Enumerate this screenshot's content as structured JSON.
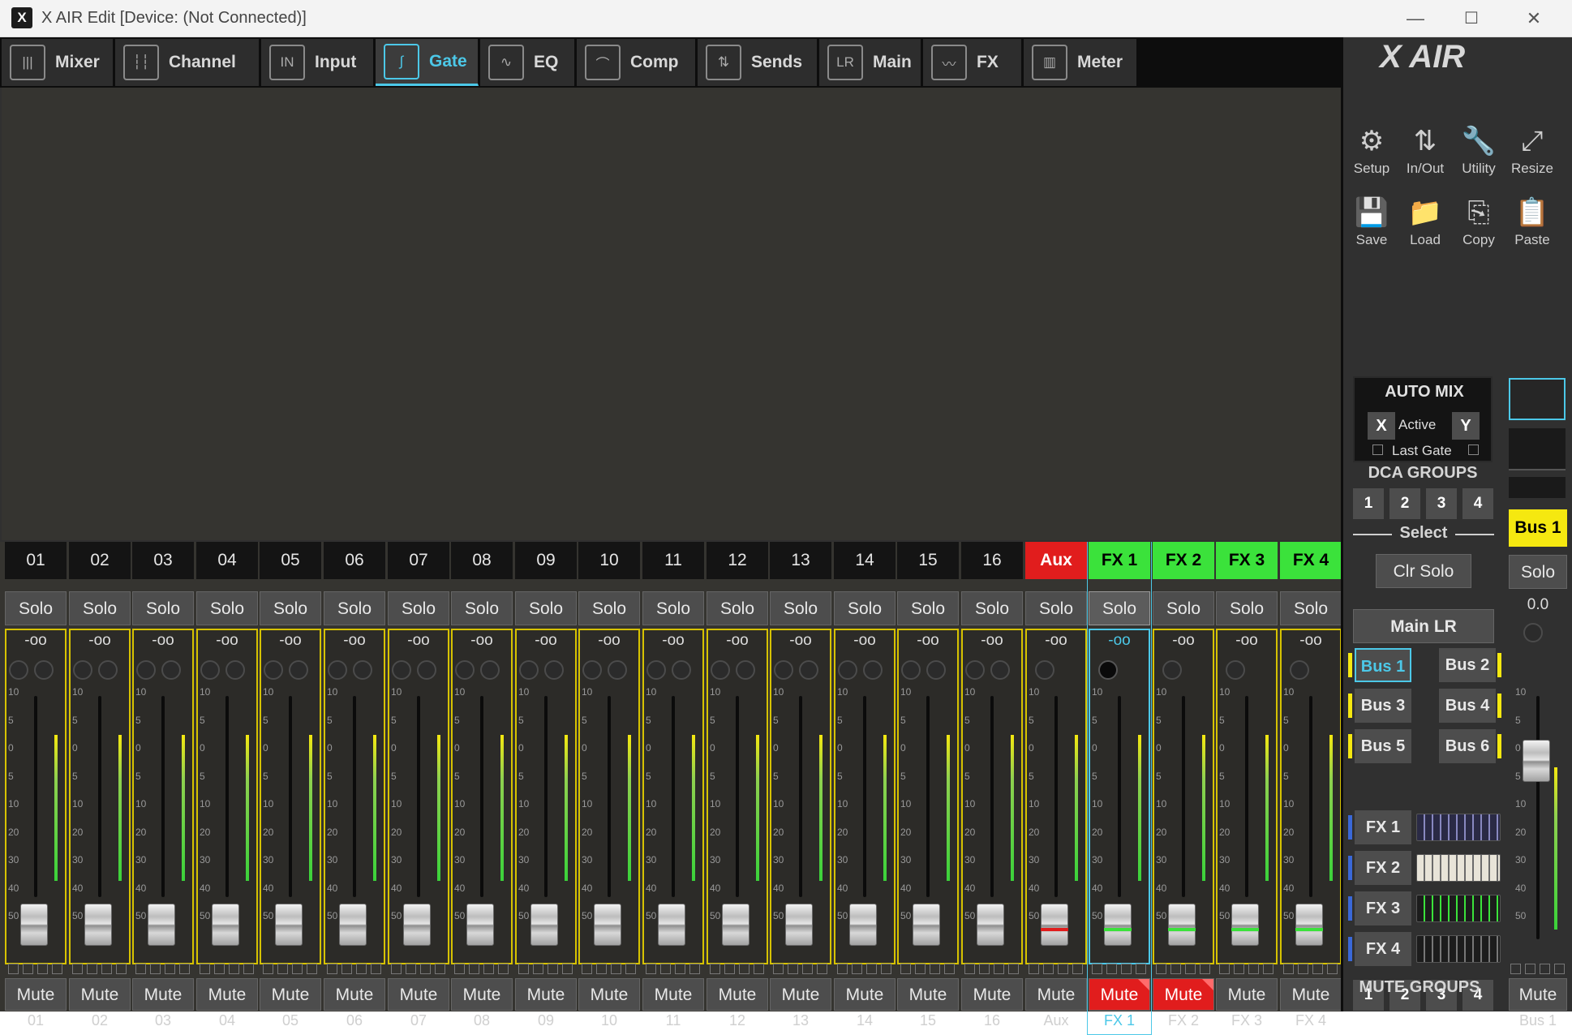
{
  "window": {
    "title": "X AIR Edit [Device: (Not Connected)]",
    "app_icon": "X",
    "minimize": "—",
    "maximize": "☐",
    "close": "✕"
  },
  "tabs": [
    {
      "label": "Mixer",
      "icon": "mixer-icon",
      "glyph": "|||"
    },
    {
      "label": "Channel",
      "icon": "channel-icon",
      "glyph": "┆┆"
    },
    {
      "label": "Input",
      "icon": "input-icon",
      "glyph": "IN"
    },
    {
      "label": "Gate",
      "icon": "gate-icon",
      "glyph": "∫"
    },
    {
      "label": "EQ",
      "icon": "eq-icon",
      "glyph": "∿"
    },
    {
      "label": "Comp",
      "icon": "comp-icon",
      "glyph": "⌒"
    },
    {
      "label": "Sends",
      "icon": "sends-icon",
      "glyph": "⇅"
    },
    {
      "label": "Main",
      "icon": "main-icon",
      "glyph": "LR"
    },
    {
      "label": "FX",
      "icon": "fx-icon",
      "glyph": "〰"
    },
    {
      "label": "Meter",
      "icon": "meter-icon",
      "glyph": "▥"
    }
  ],
  "active_tab": "Gate",
  "channels": [
    {
      "num": "01",
      "name": "01",
      "gain": "-oo",
      "solo": "Solo",
      "mute": "Mute"
    },
    {
      "num": "02",
      "name": "02",
      "gain": "-oo",
      "solo": "Solo",
      "mute": "Mute"
    },
    {
      "num": "03",
      "name": "03",
      "gain": "-oo",
      "solo": "Solo",
      "mute": "Mute"
    },
    {
      "num": "04",
      "name": "04",
      "gain": "-oo",
      "solo": "Solo",
      "mute": "Mute"
    },
    {
      "num": "05",
      "name": "05",
      "gain": "-oo",
      "solo": "Solo",
      "mute": "Mute"
    },
    {
      "num": "06",
      "name": "06",
      "gain": "-oo",
      "solo": "Solo",
      "mute": "Mute"
    },
    {
      "num": "07",
      "name": "07",
      "gain": "-oo",
      "solo": "Solo",
      "mute": "Mute"
    },
    {
      "num": "08",
      "name": "08",
      "gain": "-oo",
      "solo": "Solo",
      "mute": "Mute"
    },
    {
      "num": "09",
      "name": "09",
      "gain": "-oo",
      "solo": "Solo",
      "mute": "Mute"
    },
    {
      "num": "10",
      "name": "10",
      "gain": "-oo",
      "solo": "Solo",
      "mute": "Mute"
    },
    {
      "num": "11",
      "name": "11",
      "gain": "-oo",
      "solo": "Solo",
      "mute": "Mute"
    },
    {
      "num": "12",
      "name": "12",
      "gain": "-oo",
      "solo": "Solo",
      "mute": "Mute"
    },
    {
      "num": "13",
      "name": "13",
      "gain": "-oo",
      "solo": "Solo",
      "mute": "Mute"
    },
    {
      "num": "14",
      "name": "14",
      "gain": "-oo",
      "solo": "Solo",
      "mute": "Mute"
    },
    {
      "num": "15",
      "name": "15",
      "gain": "-oo",
      "solo": "Solo",
      "mute": "Mute"
    },
    {
      "num": "16",
      "name": "16",
      "gain": "-oo",
      "solo": "Solo",
      "mute": "Mute"
    },
    {
      "num": "Aux",
      "name": "Aux",
      "gain": "-oo",
      "solo": "Solo",
      "mute": "Mute"
    },
    {
      "num": "FX 1",
      "name": "FX 1",
      "gain": "-oo",
      "solo": "Solo",
      "mute": "Mute"
    },
    {
      "num": "FX 2",
      "name": "FX 2",
      "gain": "-oo",
      "solo": "Solo",
      "mute": "Mute"
    },
    {
      "num": "FX 3",
      "name": "FX 3",
      "gain": "-oo",
      "solo": "Solo",
      "mute": "Mute"
    },
    {
      "num": "FX 4",
      "name": "FX 4",
      "gain": "-oo",
      "solo": "Solo",
      "mute": "Mute"
    }
  ],
  "fader_scale": [
    "10",
    "5",
    "0",
    "5",
    "10",
    "20",
    "30",
    "40",
    "50"
  ],
  "colors": {
    "aux": "#e11d1d",
    "fx": "#3be23b",
    "bus": "#f5e810",
    "accent": "#4cc8e8",
    "frame": "#d6c200",
    "mute_on": "#e11d1d"
  },
  "right_panel": {
    "logo": "X AIR",
    "tools": [
      {
        "label": "Setup",
        "icon": "gear-icon",
        "glyph": "⚙"
      },
      {
        "label": "In/Out",
        "icon": "in-out-icon",
        "glyph": "⇅"
      },
      {
        "label": "Utility",
        "icon": "wrench-icon",
        "glyph": "🔧"
      },
      {
        "label": "Resize",
        "icon": "resize-icon",
        "glyph": "⤢"
      },
      {
        "label": "Save",
        "icon": "save-icon",
        "glyph": "💾"
      },
      {
        "label": "Load",
        "icon": "folder-icon",
        "glyph": "📁"
      },
      {
        "label": "Copy",
        "icon": "copy-icon",
        "glyph": "⎘"
      },
      {
        "label": "Paste",
        "icon": "paste-icon",
        "glyph": "📋"
      }
    ],
    "automix": {
      "title": "AUTO MIX",
      "x": "X",
      "y": "Y",
      "active": "Active",
      "last_gate": "Last Gate"
    },
    "dca": {
      "title": "DCA GROUPS",
      "buttons": [
        "1",
        "2",
        "3",
        "4"
      ]
    },
    "select_label": "Select",
    "clr_solo": "Clr Solo",
    "main_lr": "Main LR",
    "buses": [
      "Bus 1",
      "Bus 2",
      "Bus 3",
      "Bus 4",
      "Bus 5",
      "Bus 6"
    ],
    "fx": [
      "FX 1",
      "FX 2",
      "FX 3",
      "FX 4"
    ],
    "mute_groups": {
      "title": "MUTE GROUPS",
      "buttons": [
        "1",
        "2",
        "3",
        "4"
      ]
    },
    "bus_strip": {
      "num": "Bus 1",
      "solo": "Solo",
      "gain": "0.0",
      "mute": "Mute",
      "name": "Bus 1"
    }
  }
}
